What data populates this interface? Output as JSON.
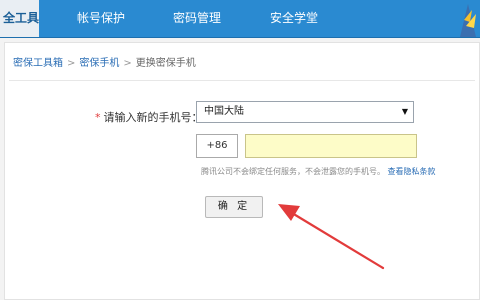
{
  "nav": {
    "tabs": [
      {
        "label": "全工具",
        "active": true
      },
      {
        "label": "帐号保护",
        "active": false
      },
      {
        "label": "密码管理",
        "active": false
      },
      {
        "label": "安全学堂",
        "active": false
      }
    ]
  },
  "breadcrumb": [
    "密保工具箱",
    "密保手机",
    "更换密保手机"
  ],
  "form": {
    "required_mark": "*",
    "phone_label": "请输入新的手机号：",
    "region_selected": "中国大陆",
    "country_code": "+86",
    "phone_value": "",
    "note_text": "腾讯公司不会绑定任何服务，不会泄露您的手机号。",
    "privacy_link": "查看隐私条款",
    "confirm_label": "确 定"
  },
  "colors": {
    "nav_bg": "#2a8ad1",
    "input_highlight": "#fdfcc8",
    "annotation_arrow": "#e23b3b"
  }
}
